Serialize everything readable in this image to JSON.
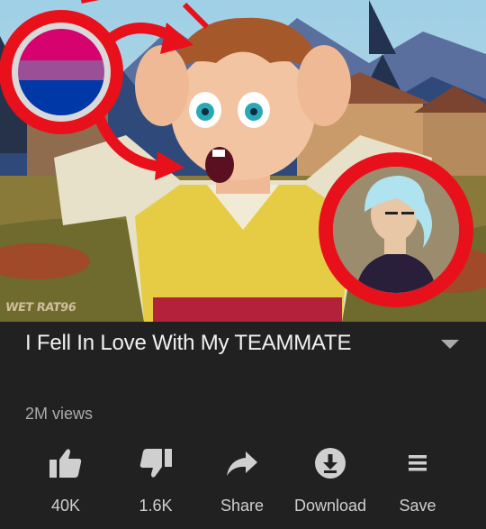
{
  "video": {
    "title": "I Fell In Love With My TEAMMATE",
    "views": "2M views",
    "watermark": "WET RAT96"
  },
  "actions": {
    "like": {
      "label": "40K",
      "icon": "thumbs-up-icon"
    },
    "dislike": {
      "label": "1.6K",
      "icon": "thumbs-down-icon"
    },
    "share": {
      "label": "Share",
      "icon": "share-arrow-icon"
    },
    "download": {
      "label": "Download",
      "icon": "download-icon"
    },
    "save": {
      "label": "Save",
      "icon": "playlist-save-icon"
    }
  },
  "colors": {
    "background": "#212121",
    "text_primary": "#f1f1f1",
    "text_secondary": "#aaaaaa",
    "icon": "#cfcfcf",
    "thumbnail_accent_red": "#e8101a"
  }
}
